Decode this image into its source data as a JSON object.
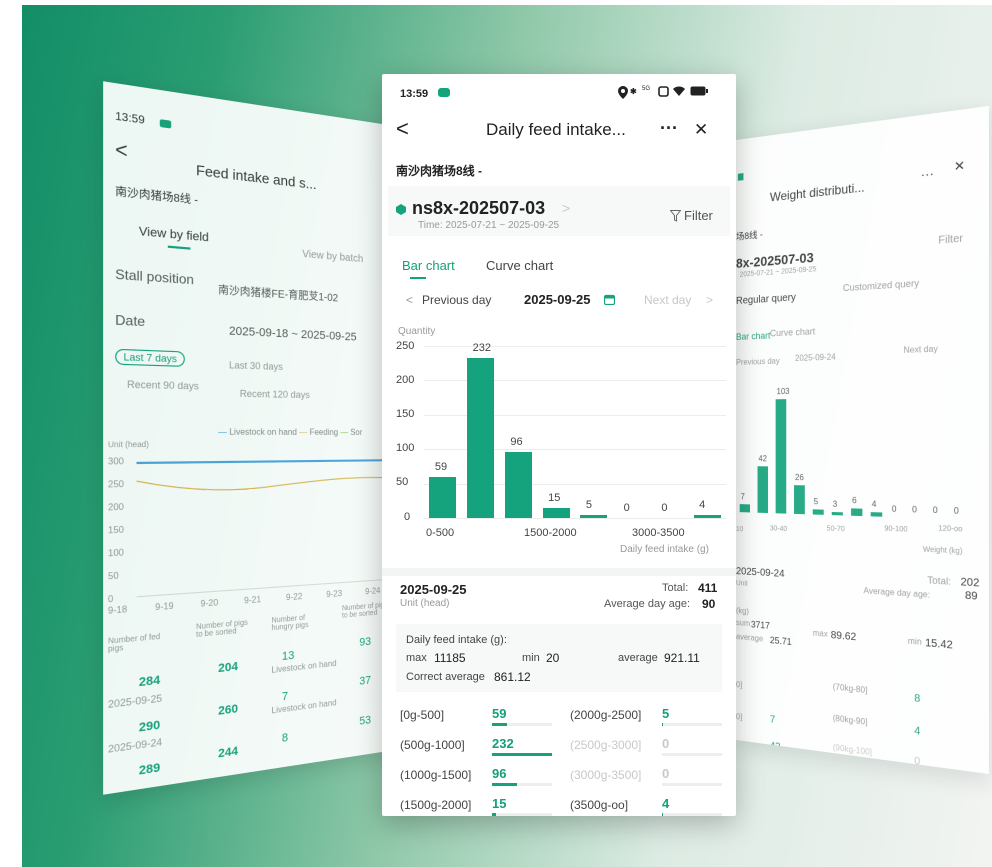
{
  "center": {
    "status": {
      "time": "13:59",
      "network": "5G"
    },
    "header": {
      "title": "Daily feed intake...",
      "more": "···",
      "close": "✕"
    },
    "farm": "南沙肉猪场8线 -",
    "batch": {
      "code": "ns8x-202507-03",
      "time": "Time:  2025-07-21 ~ 2025-09-25",
      "filter": "Filter"
    },
    "tabs": [
      "Bar chart",
      "Curve chart"
    ],
    "daynav": {
      "prev": "Previous day",
      "date": "2025-09-25",
      "next": "Next day"
    },
    "chart": {
      "ylabel": "Quantity",
      "yticks": [
        "250",
        "200",
        "150",
        "100",
        "50",
        "0"
      ],
      "xticks": [
        "0-500",
        "1500-2000",
        "3000-3500"
      ],
      "xlabel": "Daily feed intake (g)"
    },
    "summary": {
      "date": "2025-09-25",
      "unit": "Unit (head)",
      "total_label": "Total:",
      "total": "411",
      "age_label": "Average day age:",
      "age": "90"
    },
    "stats": {
      "title": "Daily feed intake (g):",
      "max_label": "max",
      "max": "11185",
      "min_label": "min",
      "min": "20",
      "avg_label": "average",
      "avg": "921.11",
      "corr_label": "Correct average",
      "corr": "861.12"
    },
    "buckets": [
      {
        "label": "[0g-500]",
        "value": "59"
      },
      {
        "label": "(2000g-2500]",
        "value": "5"
      },
      {
        "label": "(500g-1000]",
        "value": "232"
      },
      {
        "label": "(2500g-3000]",
        "value": "0"
      },
      {
        "label": "(1000g-1500]",
        "value": "96"
      },
      {
        "label": "(3000g-3500]",
        "value": "0"
      },
      {
        "label": "(1500g-2000]",
        "value": "15"
      },
      {
        "label": "(3500g-oo]",
        "value": "4"
      }
    ]
  },
  "chart_data": {
    "type": "bar",
    "categories": [
      "0-500",
      "500-1000",
      "1000-1500",
      "1500-2000",
      "2000-2500",
      "2500-3000",
      "3000-3500",
      "3500+"
    ],
    "values": [
      59,
      232,
      96,
      15,
      5,
      0,
      0,
      4
    ],
    "xlabel": "Daily feed intake (g)",
    "ylabel": "Quantity",
    "ylim": [
      0,
      250
    ],
    "grid": true
  },
  "left": {
    "time": "13:59",
    "title": "Feed intake and s...",
    "farm": "南沙肉猪场8线 -",
    "tabs": [
      "View by field",
      "View by batch"
    ],
    "stall_label": "Stall position",
    "stall_value": "南沙肉猪楼FE-育肥芆1-02",
    "date_label": "Date",
    "date_value": "2025-09-18 ~ 2025-09-25",
    "quick": [
      "Last 7 days",
      "Last 30 days",
      "Recent 90 days",
      "Recent 120 days"
    ],
    "legend": [
      "Livestock on hand",
      "Feeding",
      "Sor"
    ],
    "unit": "Unit (head)",
    "yticks": [
      "300",
      "250",
      "200",
      "150",
      "100",
      "50",
      "0"
    ],
    "xticks": [
      "9-18",
      "9-19",
      "9-20",
      "9-21",
      "9-22",
      "9-23",
      "9-24"
    ],
    "cols": [
      "Number of fed pigs",
      "Number of pigs to be sorted",
      "Number of hungry pigs",
      "Number of pigs to be sorted"
    ],
    "rows": [
      {
        "a": "284",
        "b": "204",
        "c": "13",
        "d": "93",
        "date": "2025-09-25",
        "note": "Livestock on hand"
      },
      {
        "a": "290",
        "b": "260",
        "c": "7",
        "d": "37",
        "date": "2025-09-24",
        "note": "Livestock on hand"
      },
      {
        "a": "289",
        "b": "244",
        "c": "8",
        "d": "53"
      }
    ]
  },
  "right": {
    "title": "Weight distributi...",
    "farm": "场8线 -",
    "batch": "8x-202507-03",
    "batch_time": "2025-07-21 ~ 2025-09-25",
    "filter": "Filter",
    "tabs": [
      "Regular query",
      "Customized query"
    ],
    "chart_tabs": [
      "Bar chart",
      "Curve chart"
    ],
    "prev": "Previous day",
    "date": "2025-09-24",
    "next": "Next day",
    "bar_labels": [
      "7",
      "42",
      "103",
      "26",
      "5",
      "3",
      "6",
      "4",
      "0",
      "0",
      "0",
      "0"
    ],
    "xticks": [
      "10",
      "30-40",
      "50-70",
      "90-100",
      "120-oo"
    ],
    "xlabel": "Weight (kg)",
    "sum_date": "2025-09-24",
    "unit": "Unit",
    "total_label": "Total:",
    "total": "202",
    "age_label": "Average day age:",
    "age": "89",
    "stats_kg": "(kg)",
    "sum_label": "sum",
    "sum": "3717",
    "avg_label": "average",
    "avg": "25.71",
    "max_label": "max",
    "max": "89.62",
    "min_label": "min",
    "min": "15.42",
    "list": [
      {
        "l": "0]",
        "v": "",
        "r": "(70kg-80]",
        "rv": "8"
      },
      {
        "l": "0]",
        "v": "7",
        "r": "(80kg-90]",
        "rv": "4"
      },
      {
        "l": "0]",
        "v": "42",
        "r": "(90kg-100]",
        "rv": "0"
      }
    ]
  }
}
